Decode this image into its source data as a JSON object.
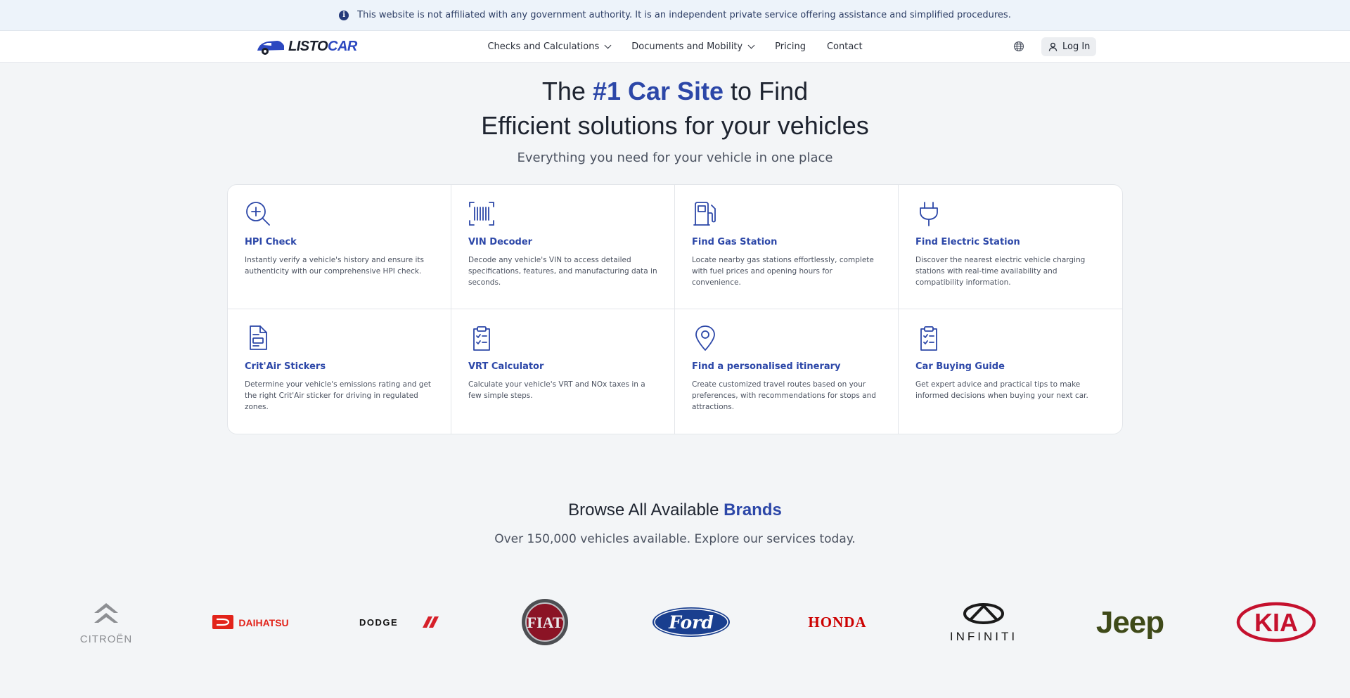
{
  "banner": {
    "text": "This website is not affiliated with any government authority. It is an independent private service offering assistance and simplified procedures."
  },
  "nav": {
    "logo_a": "LISTO",
    "logo_b": "CAR",
    "items": [
      "Checks and Calculations",
      "Documents and Mobility",
      "Pricing",
      "Contact"
    ],
    "login": "Log In"
  },
  "hero": {
    "line1_pre": "The ",
    "line1_hl": "#1 Car Site",
    "line1_post": " to Find",
    "line2": "Efficient solutions for your vehicles",
    "subtitle": "Everything you need for your vehicle in one place"
  },
  "services": [
    {
      "icon": "search-plus-icon",
      "title": "HPI Check",
      "desc": "Instantly verify a vehicle's history and ensure its authenticity with our comprehensive HPI check."
    },
    {
      "icon": "barcode-icon",
      "title": "VIN Decoder",
      "desc": "Decode any vehicle's VIN to access detailed specifications, features, and manufacturing data in seconds."
    },
    {
      "icon": "fuel-pump-icon",
      "title": "Find Gas Station",
      "desc": "Locate nearby gas stations effortlessly, complete with fuel prices and opening hours for convenience."
    },
    {
      "icon": "plug-icon",
      "title": "Find Electric Station",
      "desc": "Discover the nearest electric vehicle charging stations with real-time availability and compatibility information."
    },
    {
      "icon": "document-icon",
      "title": "Crit'Air Stickers",
      "desc": "Determine your vehicle's emissions rating and get the right Crit'Air sticker for driving in regulated zones."
    },
    {
      "icon": "clipboard-check-icon",
      "title": "VRT Calculator",
      "desc": "Calculate your vehicle's VRT and NOx taxes in a few simple steps."
    },
    {
      "icon": "map-pin-icon",
      "title": "Find a personalised itinerary",
      "desc": "Create customized travel routes based on your preferences, with recommendations for stops and attractions."
    },
    {
      "icon": "clipboard-check-icon",
      "title": "Car Buying Guide",
      "desc": "Get expert advice and practical tips to make informed decisions when buying your next car."
    }
  ],
  "brands": {
    "title_pre": "Browse All Available ",
    "title_hl": "Brands",
    "subtitle": "Over 150,000 vehicles available. Explore our services today.",
    "logos": [
      {
        "name": "citroen",
        "label": "CITROËN"
      },
      {
        "name": "daihatsu",
        "label": "DAIHATSU"
      },
      {
        "name": "dodge",
        "label": "DODGE"
      },
      {
        "name": "fiat",
        "label": "FIAT"
      },
      {
        "name": "ford",
        "label": "Ford"
      },
      {
        "name": "honda",
        "label": "HONDA"
      },
      {
        "name": "infiniti",
        "label": "INFINITI"
      },
      {
        "name": "jeep",
        "label": "Jeep"
      },
      {
        "name": "kia",
        "label": "KIA"
      }
    ]
  },
  "colors": {
    "accent": "#2c47a8",
    "banner_bg": "#edf3fa"
  }
}
